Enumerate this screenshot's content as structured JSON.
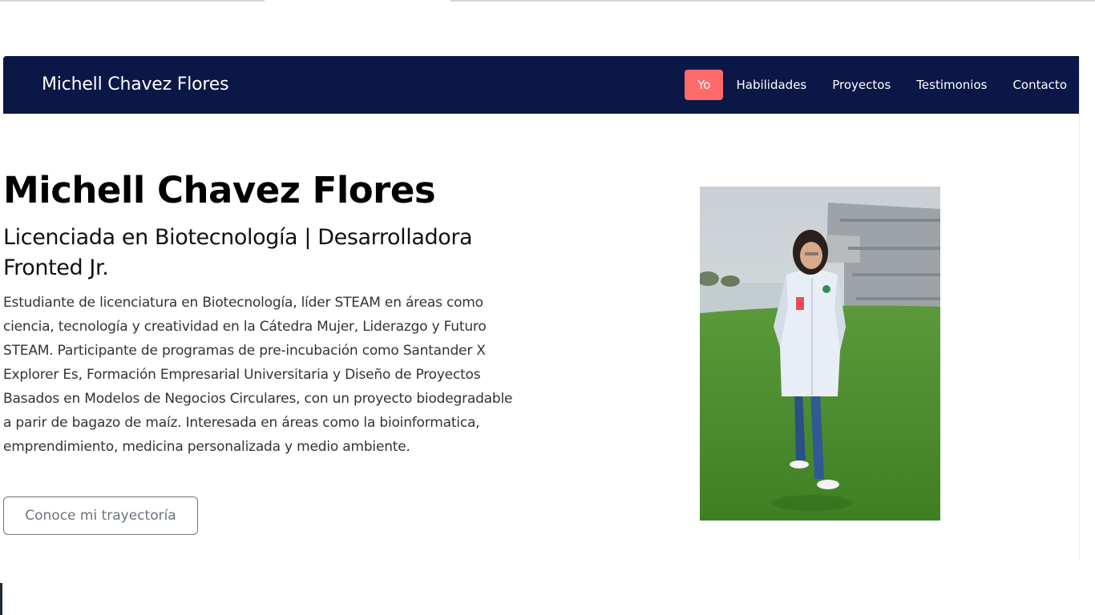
{
  "navbar": {
    "brand": "Michell Chavez Flores",
    "items": [
      {
        "label": "Yo",
        "active": true
      },
      {
        "label": "Habilidades",
        "active": false
      },
      {
        "label": "Proyectos",
        "active": false
      },
      {
        "label": "Testimonios",
        "active": false
      },
      {
        "label": "Contacto",
        "active": false
      }
    ]
  },
  "hero": {
    "title": "Michell Chavez Flores",
    "subtitle": "Licenciada en Biotecnología | Desarrolladora Fronted Jr.",
    "description": "Estudiante de licenciatura en Biotecnología, líder STEAM en áreas como ciencia, tecnología y creatividad en la Cátedra Mujer, Liderazgo y Futuro STEAM. Participante de programas de pre-incubación como Santander X Explorer Es, Formación Empresarial Universitaria y Diseño de Proyectos Basados en Modelos de Negocios Circulares, con un proyecto biodegradable a parir de bagazo de maíz. Interesada en áreas como la bioinformatica, emprendimiento, medicina personalizada y medio ambiente.",
    "cta_label": "Conoce mi trayectoría"
  },
  "colors": {
    "navbar_bg": "#0b1747",
    "active_nav_bg": "#fd6a6a",
    "button_border": "#6c757d"
  }
}
